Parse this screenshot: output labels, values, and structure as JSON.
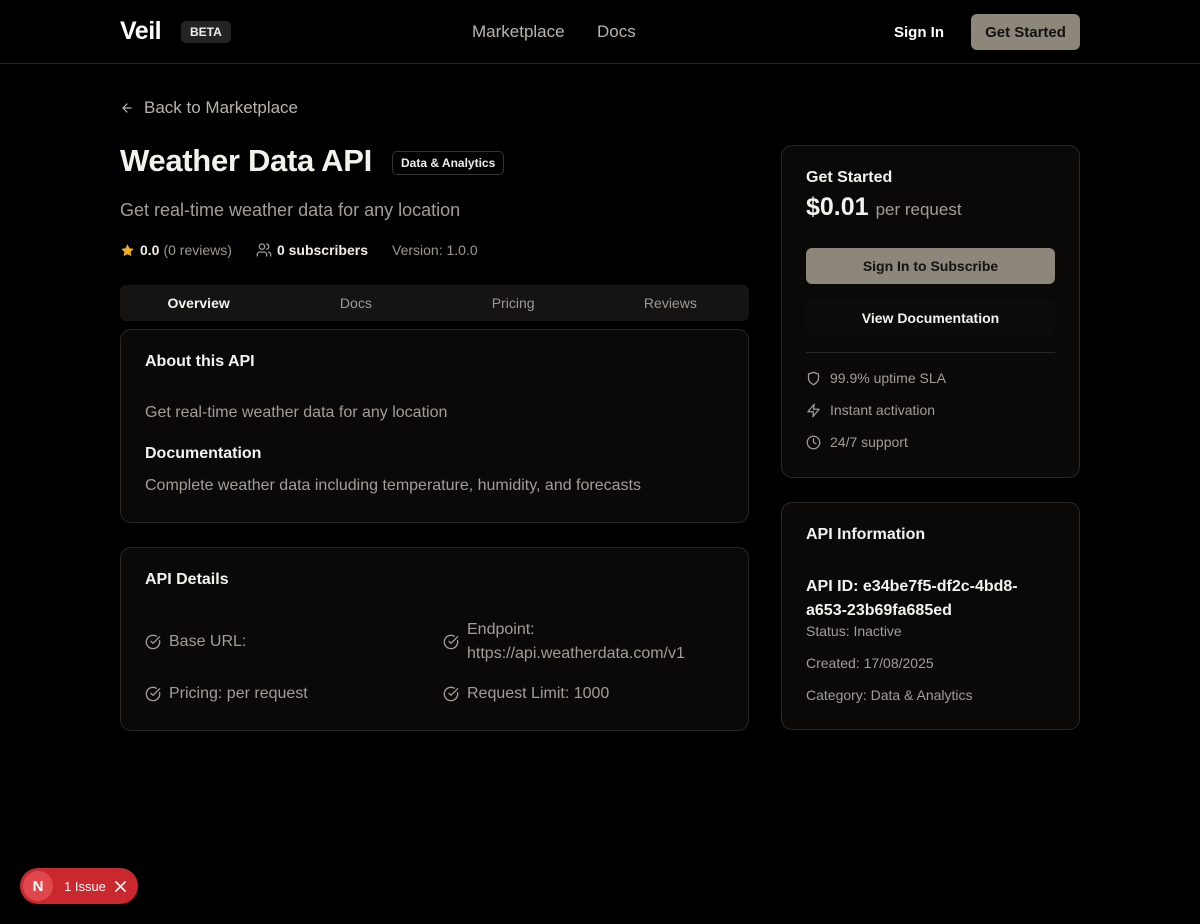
{
  "header": {
    "logo": "Veil",
    "badge": "BETA",
    "nav": [
      "Marketplace",
      "Docs"
    ],
    "sign_in": "Sign In",
    "get_started": "Get Started"
  },
  "back_link": "Back to Marketplace",
  "api": {
    "title": "Weather Data API",
    "category_badge": "Data & Analytics",
    "subtitle": "Get real-time weather data for any location",
    "rating": "0.0",
    "reviews": "(0 reviews)",
    "subscribers": "0 subscribers",
    "version": "Version: 1.0.0"
  },
  "tabs": [
    "Overview",
    "Docs",
    "Pricing",
    "Reviews"
  ],
  "about": {
    "title": "About this API",
    "description": "Get real-time weather data for any location",
    "doc_title": "Documentation",
    "doc_text": "Complete weather data including temperature, humidity, and forecasts"
  },
  "details": {
    "title": "API Details",
    "base_url": "Base URL:",
    "endpoint_label": "Endpoint:",
    "endpoint_value": "https://api.weatherdata.com/v1",
    "pricing": "Pricing: per request",
    "request_limit": "Request Limit: 1000"
  },
  "pricing_card": {
    "title": "Get Started",
    "price": "$0.01",
    "unit": "per request",
    "subscribe": "Sign In to Subscribe",
    "view_docs": "View Documentation",
    "features": [
      "99.9% uptime SLA",
      "Instant activation",
      "24/7 support"
    ]
  },
  "info_card": {
    "title": "API Information",
    "api_id_line1": "API ID: e34be7f5-df2c-4bd8-",
    "api_id_line2": "a653-23b69fa685ed",
    "status": "Status: Inactive",
    "created": "Created: 17/08/2025",
    "category": "Category: Data & Analytics"
  },
  "issue_pill": {
    "avatar": "N",
    "text": "1 Issue"
  },
  "colors": {
    "background": "#000000",
    "accent_button": "#8c867b",
    "card_border": "#2a2825",
    "star": "#f2b01e",
    "issue_red": "#c8282e"
  }
}
